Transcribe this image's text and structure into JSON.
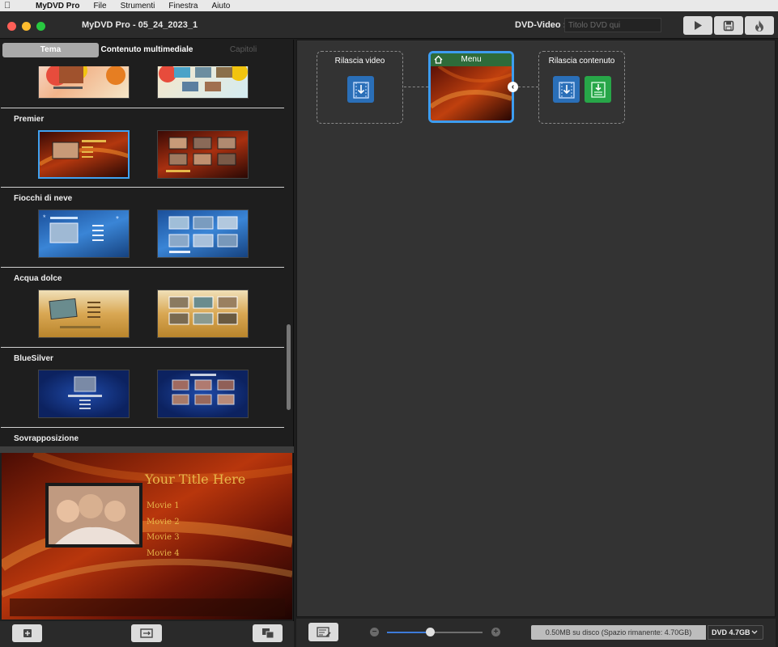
{
  "menubar": {
    "app_name": "MyDVD Pro",
    "items": [
      "File",
      "Strumenti",
      "Finestra",
      "Aiuto"
    ]
  },
  "window": {
    "title": "MyDVD Pro - 05_24_2023_1",
    "dvd_label": "DVD-Video :",
    "dvd_title_placeholder": "Titolo DVD qui",
    "toolbar_icons": [
      "play-icon",
      "save-icon",
      "burn-icon"
    ]
  },
  "left_panel": {
    "tabs": [
      {
        "label": "Tema",
        "state": "active"
      },
      {
        "label": "Contenuto multimediale",
        "state": "normal"
      },
      {
        "label": "Capitoli",
        "state": "disabled"
      }
    ],
    "theme_groups": [
      {
        "name": "",
        "thumbs": [
          "balloons-menu",
          "balloons-chapters"
        ]
      },
      {
        "name": "Premier",
        "thumbs": [
          "premier-menu",
          "premier-chapters"
        ],
        "selected": 0
      },
      {
        "name": "Fiocchi di neve",
        "thumbs": [
          "snow-menu",
          "snow-chapters"
        ]
      },
      {
        "name": "Acqua dolce",
        "thumbs": [
          "sand-menu",
          "sand-chapters"
        ]
      },
      {
        "name": "BlueSilver",
        "thumbs": [
          "bluesilver-menu",
          "bluesilver-chapters"
        ]
      },
      {
        "name": "Sovrapposizione",
        "thumbs": []
      }
    ],
    "preview": {
      "title": "Your Title Here",
      "items": [
        "Movie 1",
        "Movie 2",
        "Movie 3",
        "Movie 4"
      ]
    },
    "bottom_icons": [
      "add-icon",
      "replace-icon",
      "duplicate-icon"
    ]
  },
  "canvas": {
    "nodes": [
      {
        "label": "Rilascia video"
      },
      {
        "label": "Menu"
      },
      {
        "label": "Rilascia contenuto"
      }
    ]
  },
  "bottombar": {
    "zoom_level": 0.45,
    "disk_info": "0.50MB su disco (Spazio rimanente: 4.70GB)",
    "disk_type": "DVD 4.7GB"
  },
  "colors": {
    "accent_blue": "#3d9df0",
    "menu_header_green": "#2e6b3a",
    "tile_blue": "#2a6fb8",
    "tile_green": "#27a648"
  }
}
